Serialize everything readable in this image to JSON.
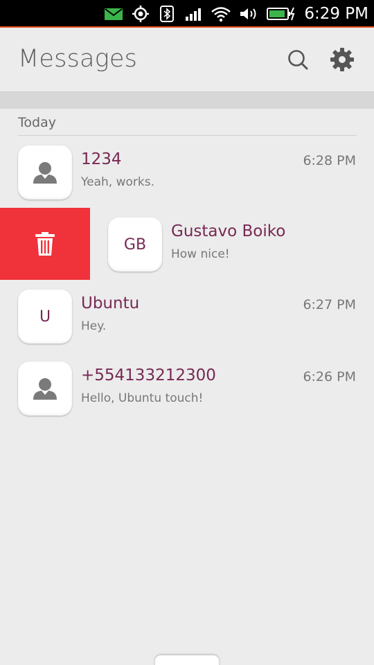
{
  "status_bar": {
    "time": "6:29 PM",
    "icons": [
      "message-icon",
      "location-icon",
      "bluetooth-icon",
      "signal-icon",
      "wifi-icon",
      "volume-icon",
      "battery-charging-icon"
    ],
    "colors": {
      "message": "#3bb54a",
      "battery": "#3bb54a",
      "accent": "#e95420"
    }
  },
  "header": {
    "title": "Messages",
    "search_icon": "search-icon",
    "settings_icon": "gear-icon"
  },
  "section": {
    "label": "Today"
  },
  "threads": [
    {
      "name": "1234",
      "preview": "Yeah, works.",
      "time": "6:28 PM",
      "avatar": "contact-icon"
    },
    {
      "name": "Gustavo Boiko",
      "preview": "How nice!",
      "time": "",
      "avatar_initials": "GB",
      "swiped": true
    },
    {
      "name": "Ubuntu",
      "preview": "Hey.",
      "time": "6:27 PM",
      "avatar_initials": "U"
    },
    {
      "name": "+554133212300",
      "preview": "Hello, Ubuntu touch!",
      "time": "6:26 PM",
      "avatar": "contact-icon"
    }
  ],
  "delete_action": {
    "icon": "trash-icon",
    "color": "#f0323b"
  },
  "colors": {
    "name": "#772953",
    "background": "#ececec"
  }
}
